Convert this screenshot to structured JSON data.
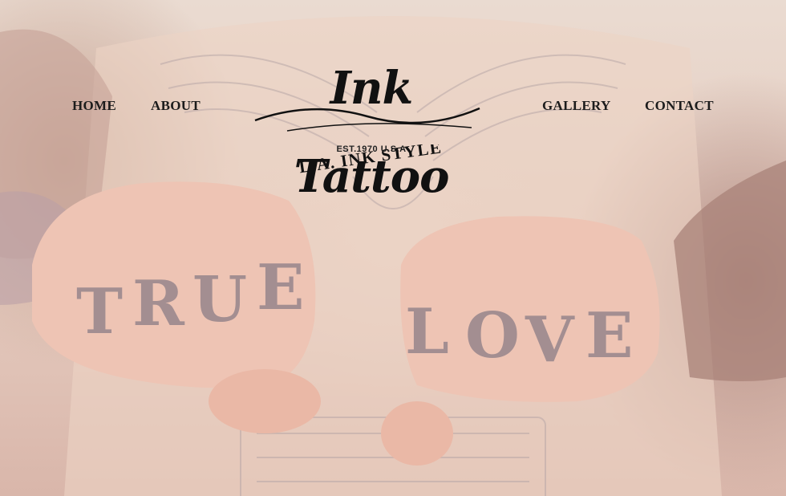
{
  "nav": {
    "home": "HOME",
    "about": "ABOUT",
    "gallery": "GALLERY",
    "contact": "CONTACT"
  },
  "logo": {
    "script": "Ink Tattoo",
    "est": "EST.1970 U.S.A",
    "style": "L.A. INK STYLE"
  },
  "hero": {
    "left_knuckles": "TRUE",
    "right_knuckles": "LOVE"
  }
}
